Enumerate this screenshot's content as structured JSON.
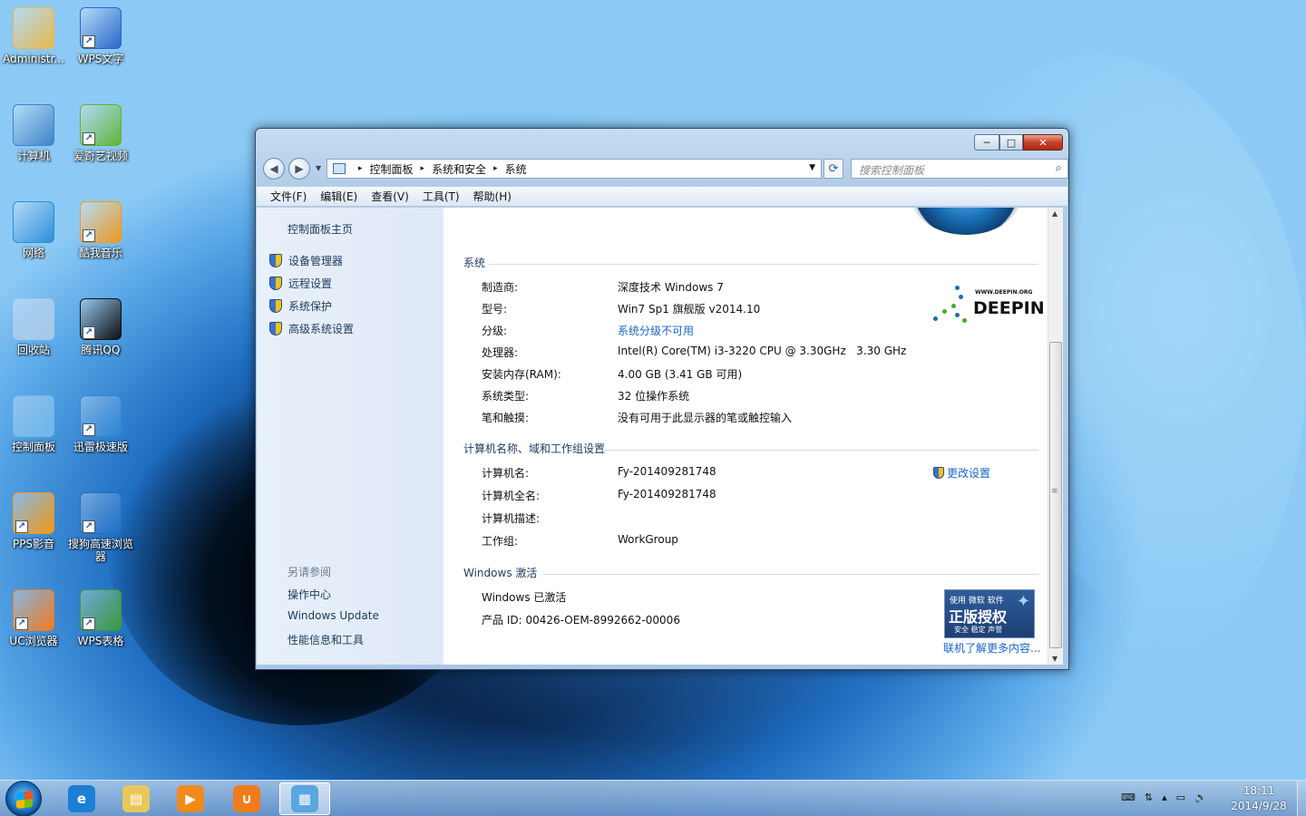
{
  "desktop": {
    "icons": [
      {
        "label": "Administr...",
        "icon": "user-folder-icon",
        "color": "#e6b84a"
      },
      {
        "label": "WPS文字",
        "icon": "wps-writer-icon",
        "color": "#2b66c9"
      },
      {
        "label": "计算机",
        "icon": "computer-icon",
        "color": "#3f83c8"
      },
      {
        "label": "爱奇艺视频",
        "icon": "iqiyi-icon",
        "color": "#5eb435"
      },
      {
        "label": "网络",
        "icon": "network-icon",
        "color": "#2d8ed8"
      },
      {
        "label": "酷我音乐",
        "icon": "kuwo-icon",
        "color": "#f19a1d"
      },
      {
        "label": "回收站",
        "icon": "recycle-bin-icon",
        "color": "#a9c8e6"
      },
      {
        "label": "腾讯QQ",
        "icon": "qq-penguin-icon",
        "color": "#111111"
      },
      {
        "label": "控制面板",
        "icon": "control-panel-icon",
        "color": "#6fb7ea"
      },
      {
        "label": "迅雷极速版",
        "icon": "xunlei-icon",
        "color": "#2f86d6"
      },
      {
        "label": "PPS影音",
        "icon": "pps-icon",
        "color": "#f39a18"
      },
      {
        "label": "搜狗高速浏览器",
        "icon": "sogou-browser-icon",
        "color": "#1f6fc4"
      },
      {
        "label": "UC浏览器",
        "icon": "uc-browser-icon",
        "color": "#f07b1c"
      },
      {
        "label": "WPS表格",
        "icon": "wps-spreadsheet-icon",
        "color": "#3a9b3c"
      }
    ]
  },
  "window": {
    "buttons": {
      "min": "─",
      "max": "□",
      "close": "✕"
    },
    "nav": {
      "back": "◀",
      "forward": "▶",
      "drop": "▼"
    },
    "breadcrumb": [
      "控制面板",
      "系统和安全",
      "系统"
    ],
    "breadcrumb_sep": "▸",
    "address_drop": "▼",
    "refresh": "⟳",
    "search_placeholder": "搜索控制面板",
    "search_icon": "⌕",
    "menu": [
      "文件(F)",
      "编辑(E)",
      "查看(V)",
      "工具(T)",
      "帮助(H)"
    ],
    "left": {
      "home": "控制面板主页",
      "tasks": [
        "设备管理器",
        "远程设置",
        "系统保护",
        "高级系统设置"
      ],
      "see_also_title": "另请参阅",
      "see_also": [
        "操作中心",
        "Windows Update",
        "性能信息和工具"
      ]
    },
    "system": {
      "heading": "系统",
      "rows": [
        {
          "label": "制造商:",
          "value": "深度技术 Windows 7"
        },
        {
          "label": "型号:",
          "value": "Win7 Sp1 旗舰版 v2014.10"
        },
        {
          "label": "分级:",
          "value": "系统分级不可用"
        },
        {
          "label": "处理器:",
          "value": "Intel(R) Core(TM) i3-3220 CPU @ 3.30GHz   3.30 GHz"
        },
        {
          "label": "安装内存(RAM):",
          "value": "4.00 GB (3.41 GB 可用)"
        },
        {
          "label": "系统类型:",
          "value": "32 位操作系统"
        },
        {
          "label": "笔和触摸:",
          "value": "没有可用于此显示器的笔或触控输入"
        }
      ],
      "logo_small": "WWW.DEEPIN.ORG",
      "logo_text": "DEEPIN"
    },
    "computer": {
      "heading": "计算机名称、域和工作组设置",
      "change_link": "更改设置",
      "rows": [
        {
          "label": "计算机名:",
          "value": "Fy-201409281748"
        },
        {
          "label": "计算机全名:",
          "value": "Fy-201409281748"
        },
        {
          "label": "计算机描述:",
          "value": ""
        },
        {
          "label": "工作组:",
          "value": "WorkGroup"
        }
      ]
    },
    "activation": {
      "heading": "Windows 激活",
      "status": "Windows 已激活",
      "product_id": "产品 ID: 00426-OEM-8992662-00006",
      "badge_line1": "使用 微软 软件",
      "badge_line2": "正版授权",
      "badge_line3": "安全 稳定 声誉",
      "more_link": "联机了解更多内容..."
    },
    "scroll": {
      "up": "▲",
      "down": "▼",
      "grip": "≡"
    }
  },
  "taskbar": {
    "apps": [
      {
        "icon": "ie-icon",
        "glyph": "e",
        "color": "#1b7fd6"
      },
      {
        "icon": "explorer-icon",
        "glyph": "▤",
        "color": "#e9c75a"
      },
      {
        "icon": "media-player-icon",
        "glyph": "▶",
        "color": "#f08a1a"
      },
      {
        "icon": "uc-browser-taskbar-icon",
        "glyph": "∪",
        "color": "#f07b1c"
      },
      {
        "icon": "control-panel-taskbar-icon",
        "glyph": "▦",
        "color": "#5aa6e0"
      }
    ],
    "tray": [
      "⌨",
      "⇅",
      "▴",
      "▭",
      "🔈"
    ],
    "time": "18:11",
    "date": "2014/9/28"
  }
}
